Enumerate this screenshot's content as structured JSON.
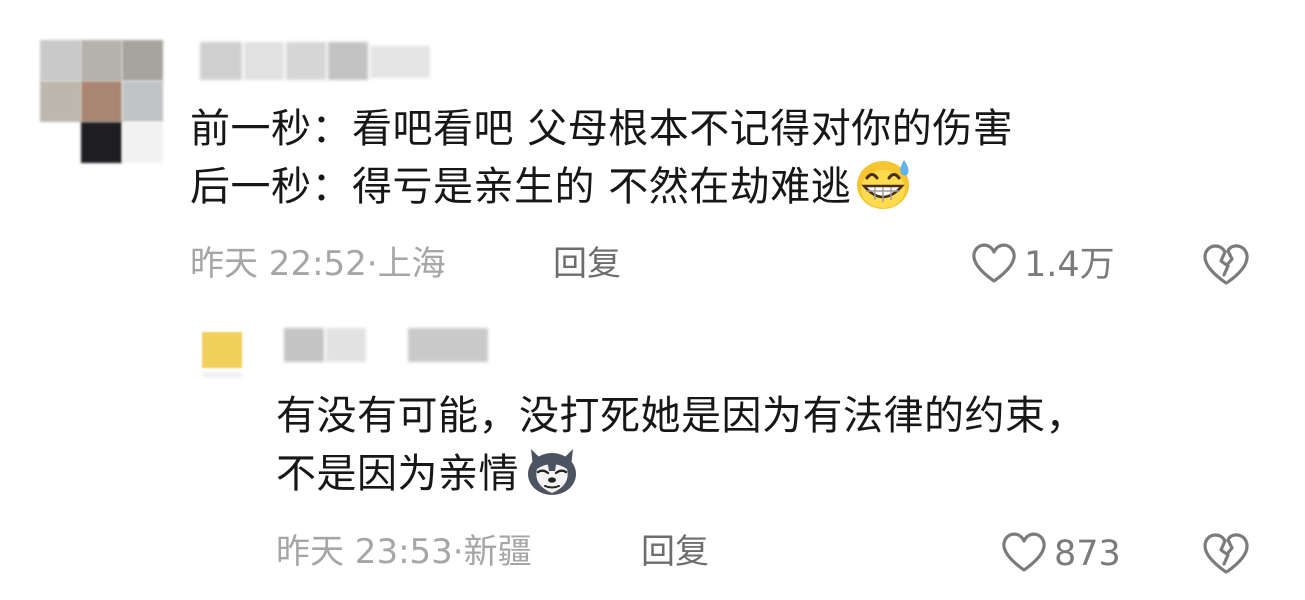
{
  "comment": {
    "line1": "前一秒：看吧看吧 父母根本不记得对你的伤害",
    "line2": "后一秒：得亏是亲生的 不然在劫难逃",
    "emoji": "sweat-grin-emoji",
    "time": "昨天 22:52",
    "location": "上海",
    "reply_label": "回复",
    "likes": "1.4万"
  },
  "reply": {
    "line1": "有没有可能，没打死她是因为有法律的约束，",
    "line2": "不是因为亲情",
    "emoji": "husky-dog-emoji",
    "time": "昨天 23:53",
    "location": "新疆",
    "reply_label": "回复",
    "likes": "873"
  },
  "separator": "·",
  "colors": {
    "text": "#171717",
    "meta": "#a6a6a6",
    "action": "#6d6d6d",
    "icon": "#7b7b7b"
  }
}
